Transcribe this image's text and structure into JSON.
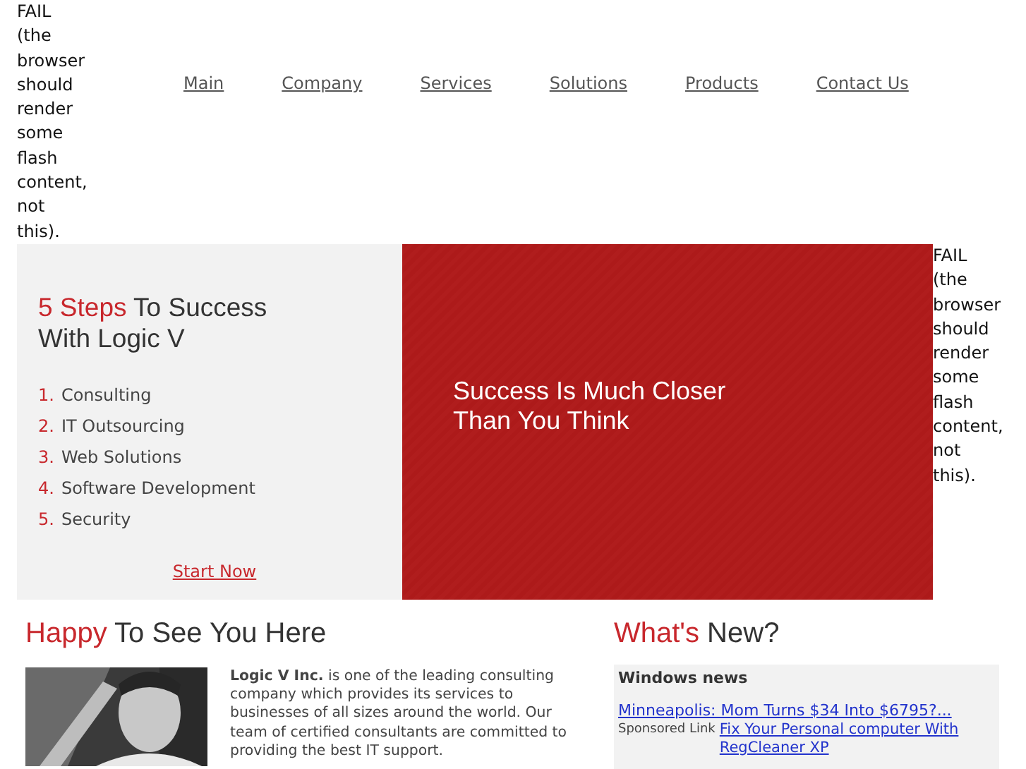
{
  "flash_fallback_left": "FAIL (the browser should render some flash content, not this).",
  "nav": [
    {
      "label": "Main"
    },
    {
      "label": "Company"
    },
    {
      "label": "Services"
    },
    {
      "label": "Solutions"
    },
    {
      "label": "Products"
    },
    {
      "label": "Contact Us"
    }
  ],
  "steps_panel": {
    "title_highlight": "5 Steps",
    "title_rest": "To Success With Logic V",
    "steps": [
      {
        "number": "1.",
        "label": "Consulting"
      },
      {
        "number": "2.",
        "label": "IT Outsourcing"
      },
      {
        "number": "3.",
        "label": "Web Solutions"
      },
      {
        "number": "4.",
        "label": "Software Development"
      },
      {
        "number": "5.",
        "label": "Security"
      }
    ],
    "link": "Start Now"
  },
  "banner": {
    "tagline": "Success Is Much Closer Than You Think"
  },
  "flash_fallback_right": "FAIL (the browser should render some flash content, not this).",
  "welcome": {
    "heading_highlight": "Happy",
    "heading_rest": "To See You Here",
    "text": "**Logic V Inc.** is one of the leading consulting company which provides its services to businesses of all sizes around the world. Our team of certified consultants are committed to providing the best IT support."
  },
  "news": {
    "heading_highlight": "What's",
    "heading_rest": "New?",
    "box_title": "Windows news",
    "headline": "Minneapolis: Mom Turns $34 Into $6795?...",
    "sponsored_label": "Sponsored Link",
    "sponsored_link": "Fix Your Personal computer With RegCleaner XP"
  }
}
